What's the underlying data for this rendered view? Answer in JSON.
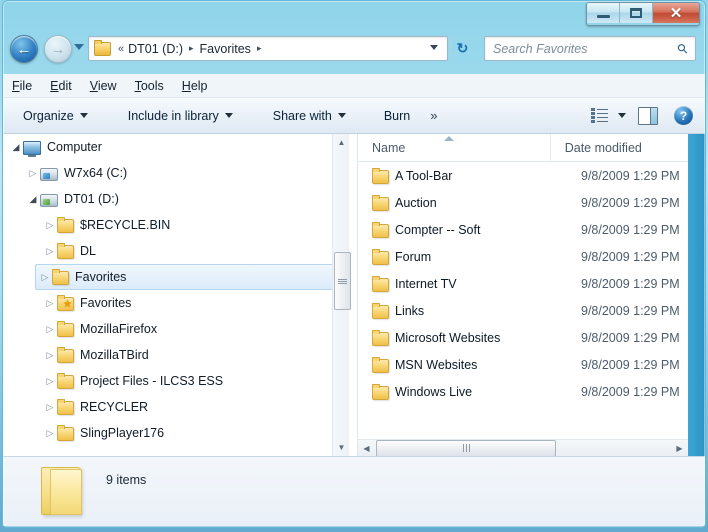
{
  "window": {
    "caption_buttons": [
      {
        "name": "minimize",
        "glyph": "minimize-icon"
      },
      {
        "name": "maximize",
        "glyph": "maximize-icon"
      },
      {
        "name": "close",
        "glyph": "✕"
      }
    ]
  },
  "navigation": {
    "back_label": "←",
    "back_title": "Back",
    "forward_label": "→",
    "forward_title": "Forward",
    "history_title": "Recent pages",
    "refresh_label": "↻",
    "refresh_title": "Refresh"
  },
  "address_bar": {
    "overflow_chevron": "«",
    "separator": "▸",
    "crumbs": [
      "DT01 (D:)",
      "Favorites"
    ],
    "dropdown_title": "Previous locations"
  },
  "search": {
    "placeholder": "Search Favorites",
    "icon": "search-icon"
  },
  "menubar": {
    "items": [
      {
        "accel": "F",
        "rest": "ile"
      },
      {
        "accel": "E",
        "rest": "dit"
      },
      {
        "accel": "V",
        "rest": "iew"
      },
      {
        "accel": "T",
        "rest": "ools"
      },
      {
        "accel": "H",
        "rest": "elp"
      }
    ]
  },
  "toolbar": {
    "organize_label": "Organize",
    "include_label": "Include in library",
    "share_label": "Share with",
    "burn_label": "Burn",
    "overflow_label": "»",
    "views_title": "Change your view",
    "preview_title": "Show the preview pane",
    "help_label": "?",
    "help_title": "Get help"
  },
  "nav_pane": {
    "items": [
      {
        "label": "Computer",
        "indent": 0,
        "expander": "◢",
        "expanded": true,
        "icon": "computer-icon",
        "selected": false
      },
      {
        "label": "W7x64 (C:)",
        "indent": 1,
        "expander": "▷",
        "expanded": false,
        "icon": "drive-win-icon",
        "selected": false
      },
      {
        "label": "DT01 (D:)",
        "indent": 1,
        "expander": "◢",
        "expanded": true,
        "icon": "drive-data-icon",
        "selected": false
      },
      {
        "label": "$RECYCLE.BIN",
        "indent": 2,
        "expander": "▷",
        "expanded": false,
        "icon": "folder-icon",
        "selected": false
      },
      {
        "label": "DL",
        "indent": 2,
        "expander": "▷",
        "expanded": false,
        "icon": "folder-icon",
        "selected": false
      },
      {
        "label": "Favorites",
        "indent": 2,
        "expander": "▷",
        "expanded": false,
        "icon": "folder-icon",
        "selected": true
      },
      {
        "label": "Favorites",
        "indent": 2,
        "expander": "▷",
        "expanded": false,
        "icon": "folder-favorites-icon",
        "selected": false
      },
      {
        "label": "MozillaFirefox",
        "indent": 2,
        "expander": "▷",
        "expanded": false,
        "icon": "folder-icon",
        "selected": false
      },
      {
        "label": "MozillaTBird",
        "indent": 2,
        "expander": "▷",
        "expanded": false,
        "icon": "folder-icon",
        "selected": false
      },
      {
        "label": "Project Files - ILCS3 ESS",
        "indent": 2,
        "expander": "▷",
        "expanded": false,
        "icon": "folder-icon",
        "selected": false
      },
      {
        "label": "RECYCLER",
        "indent": 2,
        "expander": "▷",
        "expanded": false,
        "icon": "folder-icon",
        "selected": false
      },
      {
        "label": "SlingPlayer176",
        "indent": 2,
        "expander": "▷",
        "expanded": false,
        "icon": "folder-icon",
        "selected": false
      }
    ],
    "scroll_up": "▲",
    "scroll_down": "▼"
  },
  "file_list": {
    "columns": [
      {
        "label": "Name",
        "sorted": true,
        "sort_direction": "ascending"
      },
      {
        "label": "Date modified",
        "sorted": false
      }
    ],
    "rows": [
      {
        "name": "A Tool-Bar",
        "date": "9/8/2009 1:29 PM",
        "icon": "folder-icon"
      },
      {
        "name": "Auction",
        "date": "9/8/2009 1:29 PM",
        "icon": "folder-icon"
      },
      {
        "name": "Compter -- Soft",
        "date": "9/8/2009 1:29 PM",
        "icon": "folder-icon"
      },
      {
        "name": "Forum",
        "date": "9/8/2009 1:29 PM",
        "icon": "folder-icon"
      },
      {
        "name": "Internet TV",
        "date": "9/8/2009 1:29 PM",
        "icon": "folder-icon"
      },
      {
        "name": "Links",
        "date": "9/8/2009 1:29 PM",
        "icon": "folder-icon"
      },
      {
        "name": "Microsoft Websites",
        "date": "9/8/2009 1:29 PM",
        "icon": "folder-icon"
      },
      {
        "name": "MSN Websites",
        "date": "9/8/2009 1:29 PM",
        "icon": "folder-icon"
      },
      {
        "name": "Windows Live",
        "date": "9/8/2009 1:29 PM",
        "icon": "folder-icon"
      }
    ],
    "hscroll_left": "◀",
    "hscroll_right": "▶"
  },
  "status_bar": {
    "text": "9 items"
  },
  "colors": {
    "frame": "#63b8d8",
    "selection": "#dcebfa",
    "selection_border": "#b5d5f0",
    "folder": "#f8d572",
    "close_button": "#bf4a32",
    "accent_blue": "#2574b8"
  }
}
